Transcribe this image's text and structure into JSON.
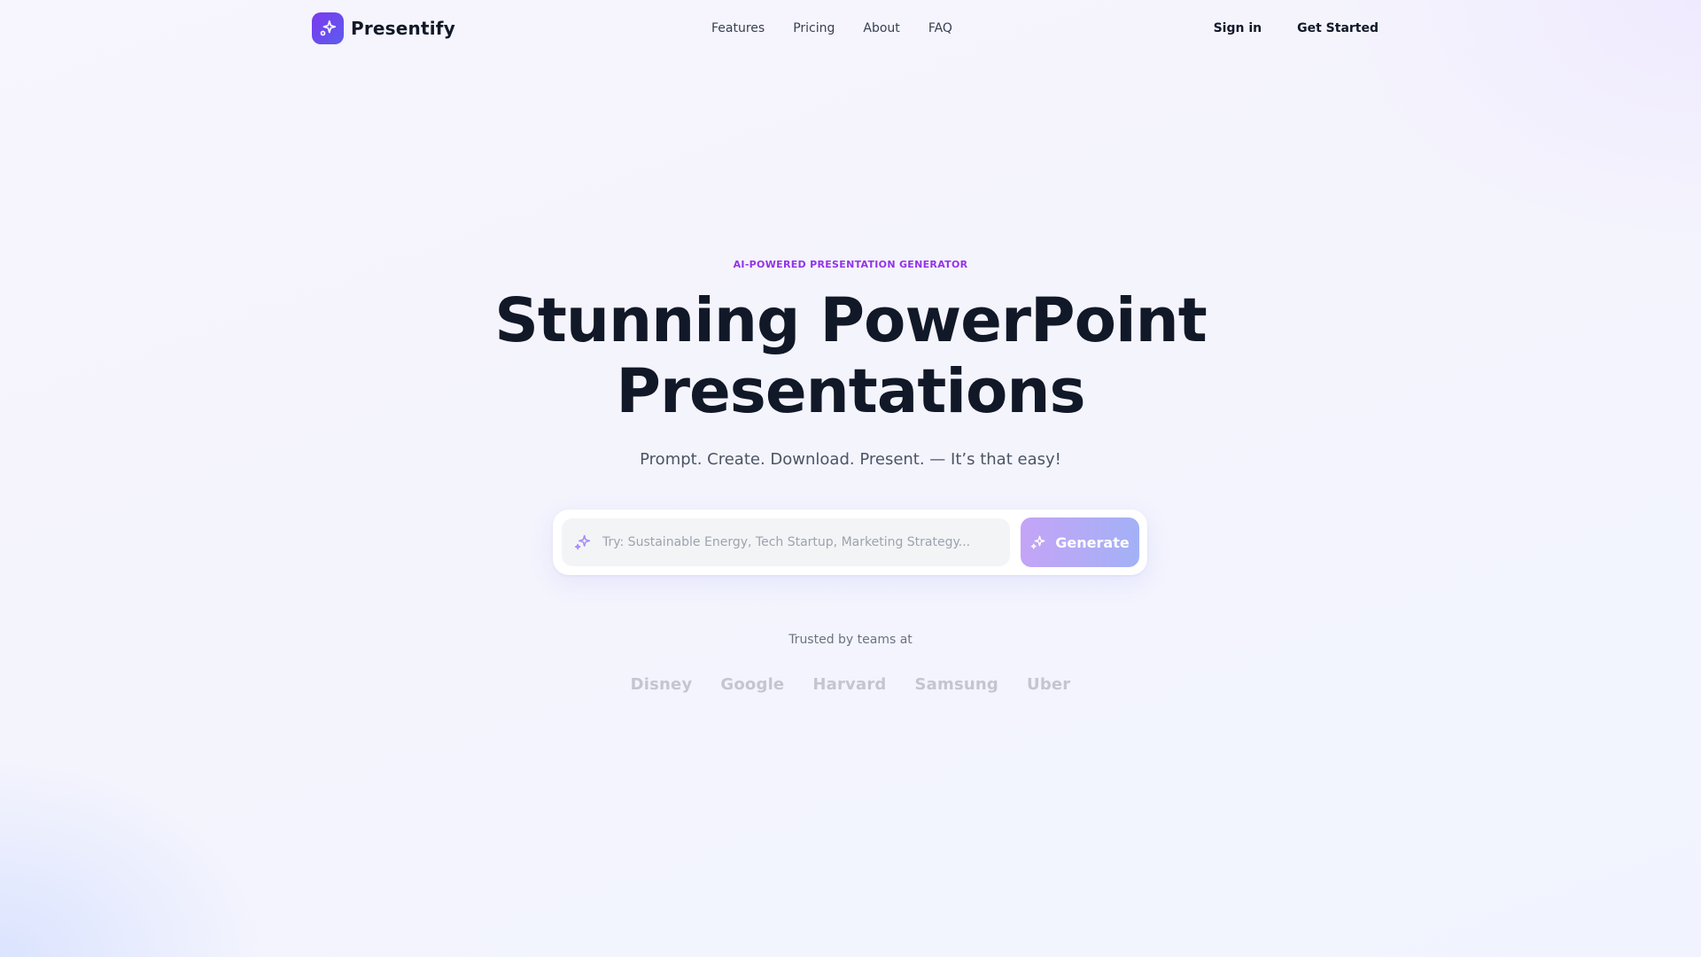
{
  "nav": {
    "brand": "Presentify",
    "links": [
      {
        "label": "Features"
      },
      {
        "label": "Pricing"
      },
      {
        "label": "About"
      },
      {
        "label": "FAQ"
      }
    ],
    "sign_in": "Sign in",
    "get_started": "Get Started"
  },
  "hero": {
    "eyebrow": "AI-POWERED PRESENTATION GENERATOR",
    "headline_line1": "Stunning PowerPoint",
    "headline_line2": "Presentations",
    "subhead": "Prompt. Create. Download. Present. — It’s that easy!"
  },
  "prompt": {
    "placeholder": "Try: Sustainable Energy, Tech Startup, Marketing Strategy...",
    "value": "",
    "generate_label": "Generate",
    "icon": "sparkles-icon"
  },
  "trusted": {
    "label": "Trusted by teams at",
    "logos": [
      "Disney",
      "Google",
      "Harvard",
      "Samsung",
      "Uber"
    ]
  },
  "colors": {
    "brand_gradient_start": "#7c3aed",
    "brand_gradient_end": "#5b5cf0",
    "eyebrow": "#9333ea",
    "generate_gradient_start": "#c4a4f6",
    "generate_gradient_end": "#a3b1f6",
    "text_primary": "#111827"
  }
}
